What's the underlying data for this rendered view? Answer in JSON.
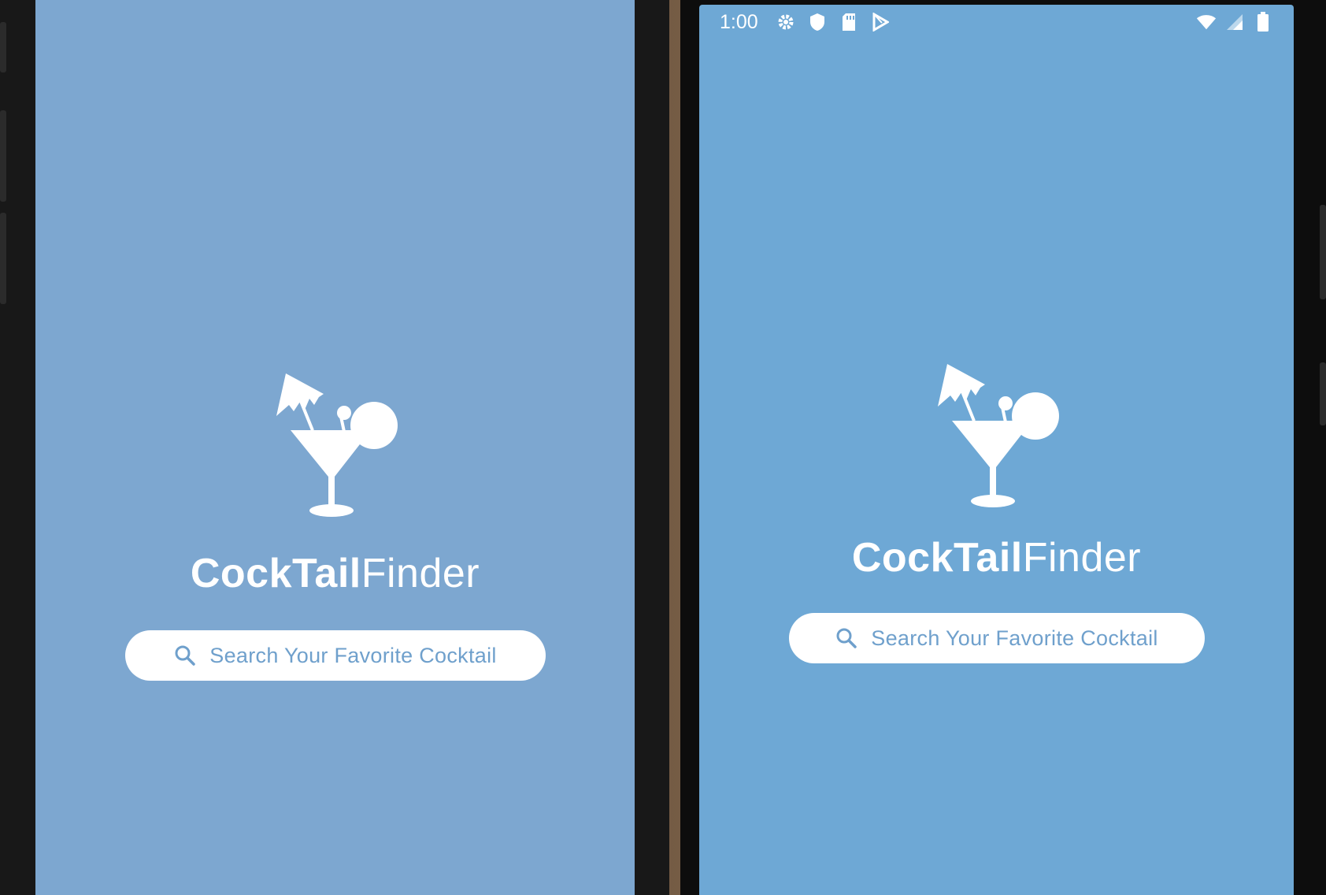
{
  "left_device": {
    "app_title_bold": "CockTail",
    "app_title_light": "Finder",
    "search_placeholder": "Search Your Favorite Cocktail"
  },
  "right_device": {
    "status_bar": {
      "time": "1:00",
      "left_icons": [
        "gear-icon",
        "shield-icon",
        "sd-card-icon",
        "play-store-icon"
      ],
      "right_icons": [
        "wifi-icon",
        "cell-signal-icon",
        "battery-icon"
      ]
    },
    "app_title_bold": "CockTail",
    "app_title_light": "Finder",
    "search_placeholder": "Search Your Favorite Cocktail"
  },
  "colors": {
    "left_screen_bg": "#7da7d0",
    "right_screen_bg": "#6ea8d5",
    "placeholder_text": "#6fa0cc",
    "white": "#ffffff"
  }
}
